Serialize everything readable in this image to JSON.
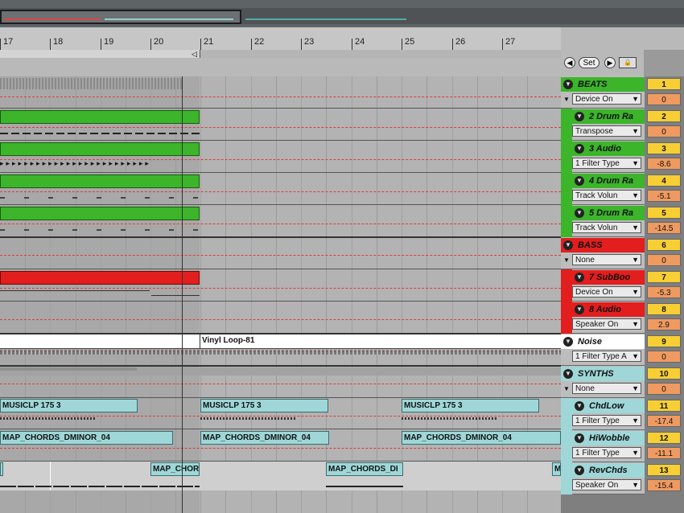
{
  "ruler": {
    "bars": [
      "17",
      "18",
      "19",
      "20",
      "21",
      "22",
      "23",
      "24",
      "25",
      "26",
      "27"
    ]
  },
  "set_controls": {
    "prev_label": "◀",
    "set_label": "Set",
    "next_label": "▶",
    "lock_label": "🔒"
  },
  "tracks": [
    {
      "name": "BEATS",
      "param": "Device On",
      "number": "1",
      "value": "0",
      "color": "#3cb52a",
      "group": true
    },
    {
      "name": "2 Drum Ra",
      "param": "Transpose",
      "number": "2",
      "value": "0",
      "color": "#3cb52a",
      "group": false
    },
    {
      "name": "3 Audio",
      "param": "1 Filter Type",
      "number": "3",
      "value": "-8.6",
      "color": "#3cb52a",
      "group": false
    },
    {
      "name": "4 Drum Ra",
      "param": "Track Volun",
      "number": "4",
      "value": "-5.1",
      "color": "#3cb52a",
      "group": false
    },
    {
      "name": "5 Drum Ra",
      "param": "Track Volun",
      "number": "5",
      "value": "-14.5",
      "color": "#3cb52a",
      "group": false
    },
    {
      "name": "BASS",
      "param": "None",
      "number": "6",
      "value": "0",
      "color": "#e21e1e",
      "group": true
    },
    {
      "name": "7 SubBoo",
      "param": "Device On",
      "number": "7",
      "value": "-5.3",
      "color": "#e21e1e",
      "group": false
    },
    {
      "name": "8 Audio",
      "param": "Speaker On",
      "number": "8",
      "value": "2.9",
      "color": "#e21e1e",
      "group": false
    },
    {
      "name": "Noise",
      "param": "1 Filter Type A",
      "number": "9",
      "value": "0",
      "color": "#ffffff",
      "group": false
    },
    {
      "name": "SYNTHS",
      "param": "None",
      "number": "10",
      "value": "0",
      "color": "#9fd7d8",
      "group": true
    },
    {
      "name": "ChdLow",
      "param": "1 Filter Type",
      "number": "11",
      "value": "-17.4",
      "color": "#9fd7d8",
      "group": false
    },
    {
      "name": "HiWobble",
      "param": "1 Filter Type",
      "number": "12",
      "value": "-11.1",
      "color": "#9fd7d8",
      "group": false
    },
    {
      "name": "RevChds",
      "param": "Speaker On",
      "number": "13",
      "value": "-15.4",
      "color": "#9fd7d8",
      "group": false
    }
  ],
  "clips": {
    "vinyl": "Vinyl Loop-81",
    "musicclp": "MUSICLP 175 3",
    "chords": "MAP_CHORDS_DMINOR_04",
    "chords_short": "MAP_CHOR",
    "chords_mid": "MAP_CHORDS_DI",
    "m_label": "M"
  },
  "colors": {
    "beats": "#3cb52a",
    "bass": "#e21e1e",
    "synths": "#9fd7d8",
    "noise": "#ffffff",
    "value_yellow": "#f7cf35",
    "value_orange": "#ef9a60"
  }
}
